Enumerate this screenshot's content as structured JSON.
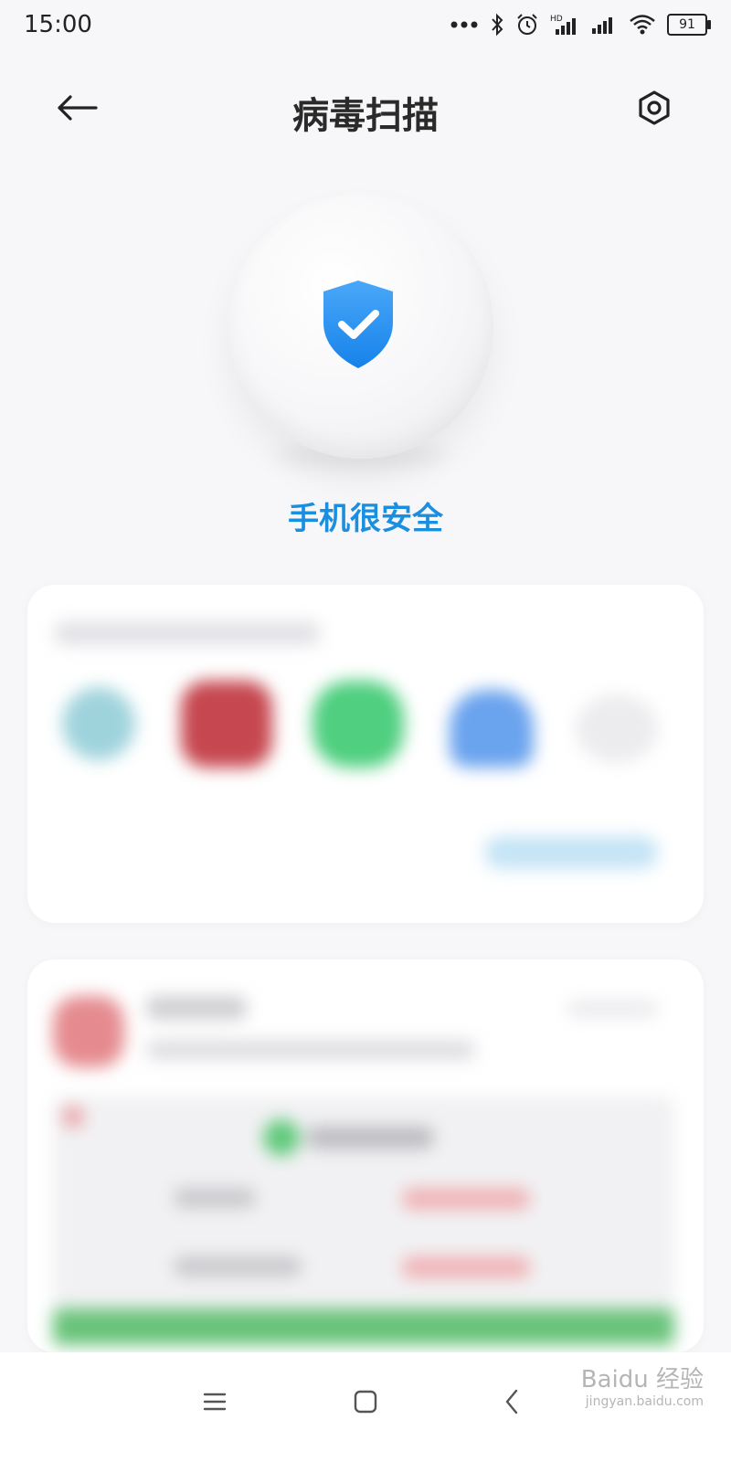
{
  "status_bar": {
    "time": "15:00",
    "battery": "91",
    "icons": [
      "dots-icon",
      "bluetooth-icon",
      "alarm-icon",
      "hd-signal-icon",
      "signal-icon",
      "wifi-icon",
      "battery-icon"
    ]
  },
  "header": {
    "title": "病毒扫描",
    "back_icon": "back-arrow-icon",
    "settings_icon": "settings-icon"
  },
  "hero": {
    "icon": "shield-check-icon",
    "status_text": "手机很安全"
  },
  "colors": {
    "accent": "#1a8fe0",
    "background": "#f7f7f9"
  },
  "nav": {
    "menu_icon": "menu-icon",
    "home_icon": "home-icon",
    "back_icon": "nav-back-icon"
  },
  "watermark": {
    "brand": "Baidu 经验",
    "url": "jingyan.baidu.com"
  }
}
